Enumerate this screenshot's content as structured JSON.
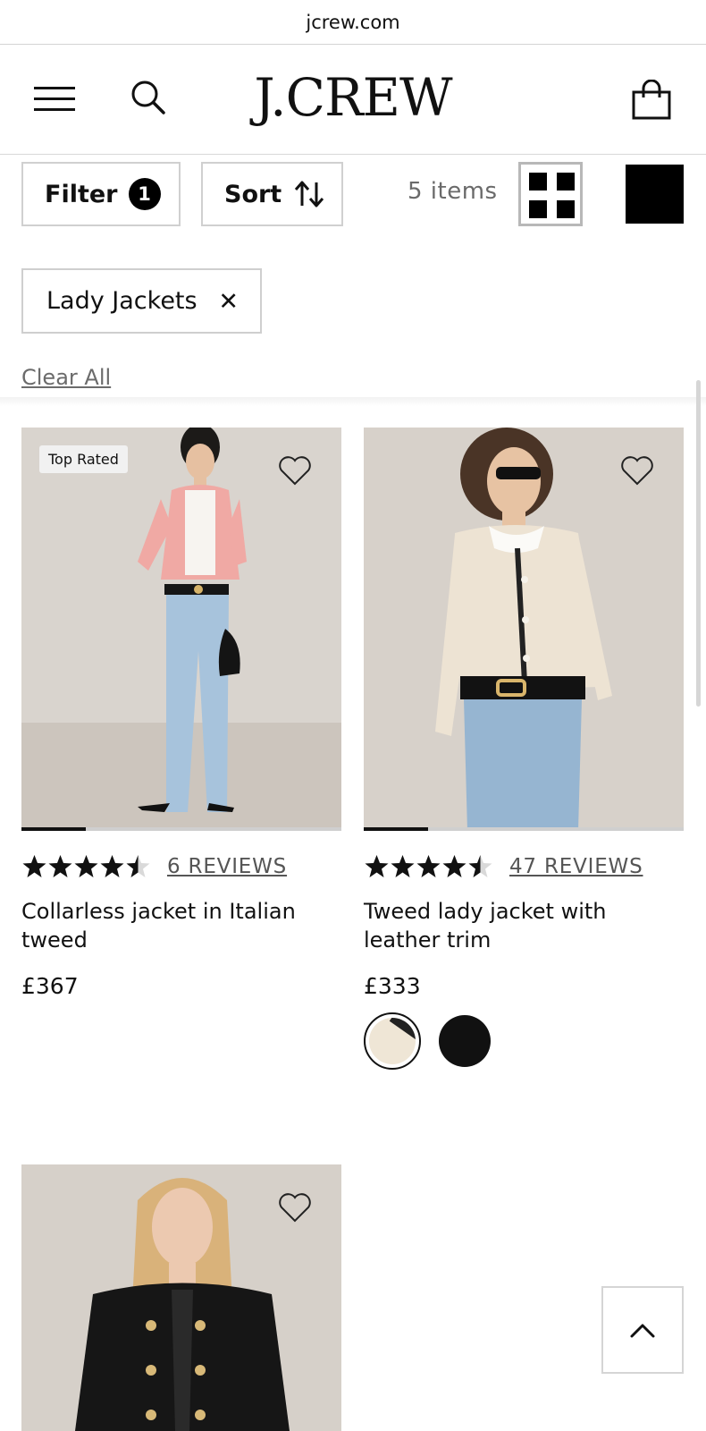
{
  "browser": {
    "url": "jcrew.com"
  },
  "header": {
    "logo": "J.CREW",
    "menu_icon": "hamburger-menu-icon",
    "search_icon": "search-icon",
    "bag_icon": "shopping-bag-icon"
  },
  "toolbar": {
    "filter_label": "Filter",
    "filter_count": "1",
    "sort_label": "Sort",
    "item_count": "5 items"
  },
  "active_filters": [
    {
      "label": "Lady Jackets",
      "remove": "✕"
    }
  ],
  "clear_all_label": "Clear All",
  "products": [
    {
      "badge": "Top Rated",
      "rating": 4.5,
      "reviews": "6 REVIEWS",
      "name": "Collarless jacket in Italian tweed",
      "price": "£367",
      "image_progress": 0.2,
      "colors": {
        "jacket": "#f2a9a5",
        "jeans": "#a9c4dd",
        "bg": "#d8d3cd"
      }
    },
    {
      "badge": "",
      "rating": 4.5,
      "reviews": "47 REVIEWS",
      "name": "Tweed lady jacket with leather trim",
      "price": "£333",
      "image_progress": 0.2,
      "swatches": [
        "ivory",
        "black"
      ],
      "colors": {
        "jacket": "#ede3d2",
        "jeans": "#93b3d1",
        "bg": "#d6d0c9"
      }
    },
    {
      "badge": "",
      "colors": {
        "jacket": "#141414",
        "hair": "#d9b27a",
        "bg": "#d5cfc8"
      }
    }
  ],
  "back_to_top_icon": "chevron-up-icon"
}
